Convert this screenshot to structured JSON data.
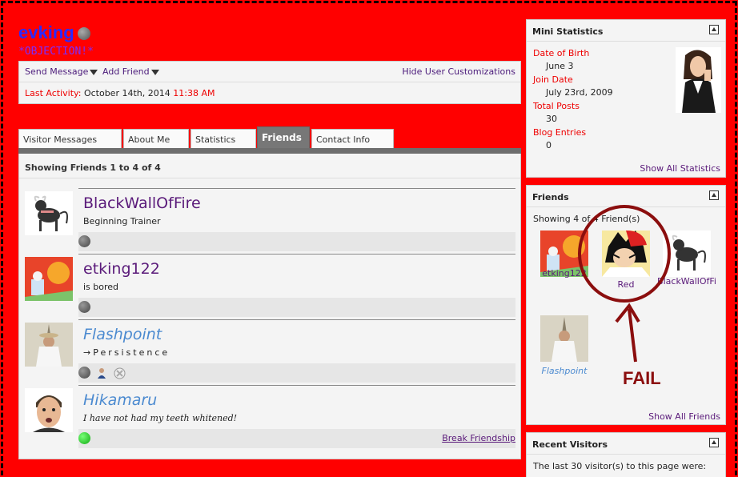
{
  "profile": {
    "username": "evking",
    "usertitle": "*OBJECTION!*",
    "send_message": "Send Message",
    "add_friend": "Add Friend",
    "hide_customizations": "Hide User Customizations",
    "last_activity_label": "Last Activity:",
    "last_activity_date": "October 14th, 2014",
    "last_activity_time": "11:38 AM"
  },
  "tabs": [
    "Visitor Messages",
    "About Me",
    "Statistics",
    "Friends",
    "Contact Info"
  ],
  "friends_panel": {
    "showing": "Showing Friends 1 to 4 of 4",
    "break_friendship": "Break Friendship",
    "friends": [
      {
        "name": "BlackWallOfFire",
        "subtitle": "Beginning Trainer"
      },
      {
        "name": "etking122",
        "subtitle": "is bored"
      },
      {
        "name": "Flashpoint",
        "subtitle": "→Persistence"
      },
      {
        "name": "Hikamaru",
        "subtitle": "I have not had my teeth whitened!"
      }
    ]
  },
  "mini_stats": {
    "title": "Mini Statistics",
    "dob_label": "Date of Birth",
    "dob": "June 3",
    "join_label": "Join Date",
    "join": "July 23rd, 2009",
    "posts_label": "Total Posts",
    "posts": "30",
    "blog_label": "Blog Entries",
    "blog": "0",
    "show_all": "Show All Statistics"
  },
  "friends_box": {
    "title": "Friends",
    "showing": "Showing 4 of 4 Friend(s)",
    "names": [
      "etking122",
      "Red",
      "BlackWallOfFi",
      "Flashpoint"
    ],
    "show_all": "Show All Friends"
  },
  "recent_visitors": {
    "title": "Recent Visitors",
    "text": "The last 30 visitor(s) to this page were:"
  },
  "annotation": {
    "fail": "FAIL"
  }
}
